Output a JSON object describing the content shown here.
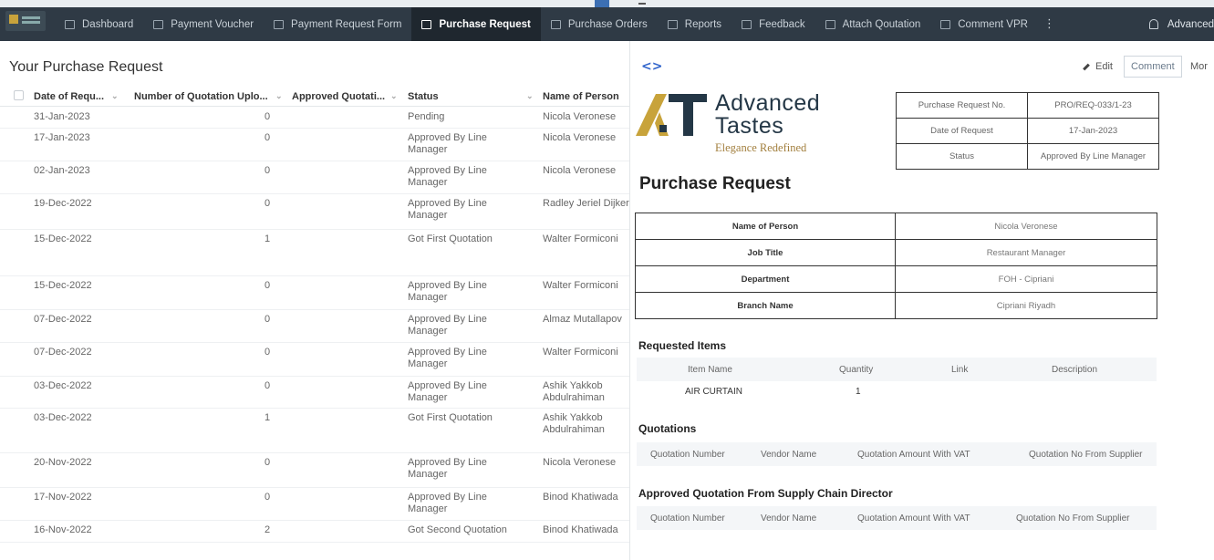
{
  "nav": {
    "items": [
      {
        "label": "Dashboard",
        "icon": "monitor-icon"
      },
      {
        "label": "Payment Voucher",
        "icon": "receipt-icon"
      },
      {
        "label": "Payment Request Form",
        "icon": "monitor-icon"
      },
      {
        "label": "Purchase Request",
        "icon": "clipboard-icon",
        "active": true
      },
      {
        "label": "Purchase Orders",
        "icon": "document-icon"
      },
      {
        "label": "Reports",
        "icon": "table-icon"
      },
      {
        "label": "Feedback",
        "icon": "chat-icon"
      },
      {
        "label": "Attach Qoutation",
        "icon": "attach-icon"
      },
      {
        "label": "Comment VPR",
        "icon": "monitor-icon"
      }
    ],
    "more": "⋮",
    "user": "Advanced"
  },
  "list": {
    "title": "Your Purchase Request",
    "columns": [
      "Date of Requ...",
      "Number of Quotation Uplo...",
      "Approved Quotati...",
      "Status",
      "Name of Person"
    ],
    "rows": [
      {
        "date": "31-Jan-2023",
        "num": "0",
        "status": "Pending",
        "person": "Nicola Veronese"
      },
      {
        "date": "17-Jan-2023",
        "num": "0",
        "status": "Approved By Line Manager",
        "person": "Nicola Veronese"
      },
      {
        "date": "02-Jan-2023",
        "num": "0",
        "status": "Approved By Line Manager",
        "person": "Nicola Veronese"
      },
      {
        "date": "19-Dec-2022",
        "num": "0",
        "status": "Approved By Line Manager",
        "person": "Radley Jeriel Dijker"
      },
      {
        "date": "15-Dec-2022",
        "num": "1",
        "status": "Got First Quotation",
        "person": "Walter Formiconi"
      },
      {
        "date": "15-Dec-2022",
        "num": "0",
        "status": "Approved By Line Manager",
        "person": "Walter Formiconi"
      },
      {
        "date": "07-Dec-2022",
        "num": "0",
        "status": "Approved By Line Manager",
        "person": "Almaz Mutallapov"
      },
      {
        "date": "07-Dec-2022",
        "num": "0",
        "status": "Approved By Line Manager",
        "person": "Walter Formiconi"
      },
      {
        "date": "03-Dec-2022",
        "num": "0",
        "status": "Approved By Line Manager",
        "person": "Ashik Yakkob Abdulrahiman"
      },
      {
        "date": "03-Dec-2022",
        "num": "1",
        "status": "Got First Quotation",
        "person": "Ashik Yakkob Abdulrahiman"
      },
      {
        "date": "20-Nov-2022",
        "num": "0",
        "status": "Approved By Line Manager",
        "person": "Nicola Veronese"
      },
      {
        "date": "17-Nov-2022",
        "num": "0",
        "status": "Approved By Line Manager",
        "person": "Binod Khatiwada"
      },
      {
        "date": "16-Nov-2022",
        "num": "2",
        "status": "Got Second Quotation",
        "person": "Binod Khatiwada"
      }
    ]
  },
  "detail": {
    "toggle": "<>",
    "edit": "Edit",
    "comment": "Comment",
    "more": "Mor",
    "brand": {
      "line1": "Advanced",
      "line2": "Tastes",
      "tagline": "Elegance Redefined"
    },
    "info": [
      {
        "k": "Purchase Request No.",
        "v": "PRO/REQ-033/1-23"
      },
      {
        "k": "Date of Request",
        "v": "17-Jan-2023"
      },
      {
        "k": "Status",
        "v": "Approved By Line Manager"
      }
    ],
    "title": "Purchase Request",
    "person": [
      {
        "k": "Name of Person",
        "v": "Nicola Veronese"
      },
      {
        "k": "Job Title",
        "v": "Restaurant Manager"
      },
      {
        "k": "Department",
        "v": "FOH - Cipriani"
      },
      {
        "k": "Branch Name",
        "v": "Cipriani Riyadh"
      }
    ],
    "requested": {
      "title": "Requested Items",
      "headers": [
        "Item Name",
        "Quantity",
        "Link",
        "Description"
      ],
      "items": [
        {
          "name": "AIR CURTAIN",
          "qty": "1"
        }
      ]
    },
    "quotations": {
      "title": "Quotations",
      "headers": [
        "Quotation Number",
        "Vendor Name",
        "Quotation Amount With VAT",
        "Quotation No From Supplier"
      ]
    },
    "approved": {
      "title": "Approved Quotation From Supply Chain Director",
      "headers": [
        "Quotation Number",
        "Vendor Name",
        "Quotation Amount With VAT",
        "Quotation No From Supplier"
      ]
    }
  },
  "colors": {
    "nav_bg": "#2f3a45",
    "nav_active": "#1f272f",
    "brand_navy": "#243746",
    "brand_gold": "#c8a33b",
    "link_blue": "#3366cc"
  }
}
